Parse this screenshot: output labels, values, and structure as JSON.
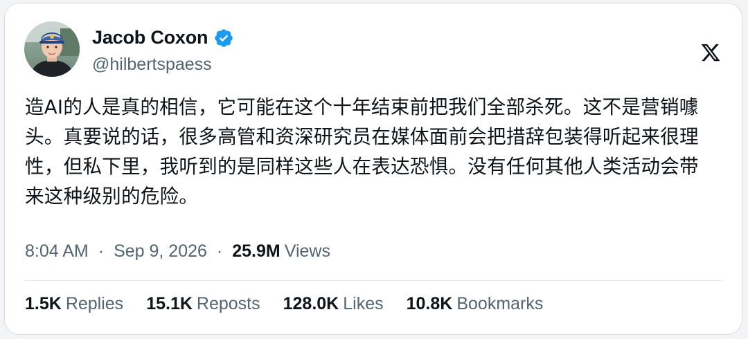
{
  "author": {
    "name": "Jacob Coxon",
    "handle": "@hilbertspaess",
    "verified": true
  },
  "tweet": {
    "text": "造AI的人是真的相信，它可能在这个十年结束前把我们全部杀死。这不是营销噱头。真要说的话，很多高管和资深研究员在媒体面前会把措辞包装得听起来很理性，但私下里，我听到的是同样这些人在表达恐惧。没有任何其他人类活动会带来这种级别的危险。",
    "time": "8:04 AM",
    "date": "Sep 9, 2026",
    "separator": "·",
    "views_count": "25.9M",
    "views_label": "Views"
  },
  "stats": {
    "replies_count": "1.5K",
    "replies_label": "Replies",
    "reposts_count": "15.1K",
    "reposts_label": "Reposts",
    "likes_count": "128.0K",
    "likes_label": "Likes",
    "bookmarks_count": "10.8K",
    "bookmarks_label": "Bookmarks"
  },
  "colors": {
    "verified_blue": "#1d9bf0",
    "secondary_text": "#536471",
    "primary_text": "#0f1419"
  },
  "icons": {
    "brand": "x-logo-icon",
    "badge": "verified-badge-icon"
  }
}
